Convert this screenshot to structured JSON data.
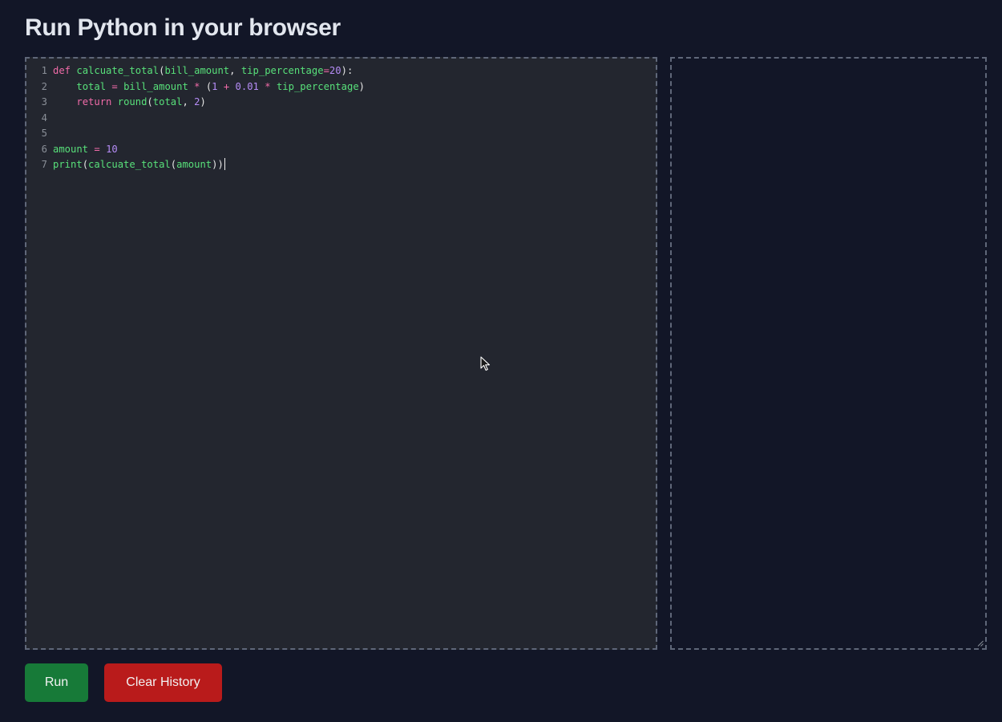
{
  "header": {
    "title": "Run Python in your browser"
  },
  "editor": {
    "lines": [
      {
        "number": "1"
      },
      {
        "number": "2"
      },
      {
        "number": "3"
      },
      {
        "number": "4"
      },
      {
        "number": "5"
      },
      {
        "number": "6"
      },
      {
        "number": "7"
      }
    ],
    "tokens": {
      "l1": [
        "def",
        " ",
        "calcuate_total",
        "(",
        "bill_amount",
        ", ",
        "tip_percentage",
        "=",
        "20",
        "):"
      ],
      "l2": [
        "    ",
        "total",
        " ",
        "=",
        " ",
        "bill_amount",
        " ",
        "*",
        " (",
        "1",
        " ",
        "+",
        " ",
        "0.01",
        " ",
        "*",
        " ",
        "tip_percentage",
        ")"
      ],
      "l3": [
        "    ",
        "return",
        " ",
        "round",
        "(",
        "total",
        ", ",
        "2",
        ")"
      ],
      "l6": [
        "amount",
        " ",
        "=",
        " ",
        "10"
      ],
      "l7": [
        "print",
        "(",
        "calcuate_total",
        "(",
        "amount",
        "))"
      ]
    }
  },
  "actions": {
    "run_label": "Run",
    "clear_label": "Clear History"
  },
  "colors": {
    "background": "#121627",
    "editor_background": "#23262f",
    "keyword": "#f06ba8",
    "identifier": "#58e07a",
    "number": "#b58cf6",
    "run_button": "#177a38",
    "clear_button": "#b91b1b"
  },
  "icons": {
    "mouse_cursor": "arrow-cursor-icon",
    "resize": "resize-grip-icon"
  }
}
